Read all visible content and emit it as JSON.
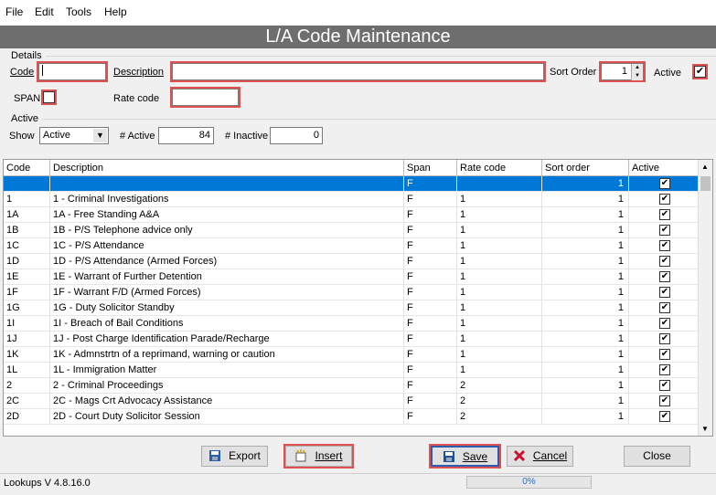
{
  "menu": [
    "File",
    "Edit",
    "Tools",
    "Help"
  ],
  "title": "L/A Code Maintenance",
  "details": {
    "group_label": "Details",
    "code_label": "Code",
    "code_value": "",
    "description_label": "Description",
    "description_value": "",
    "sort_order_label": "Sort Order",
    "sort_order_value": "1",
    "active_label": "Active",
    "active_checked": true,
    "span_label": "SPAN",
    "span_checked": false,
    "rate_code_label": "Rate code",
    "rate_code_value": ""
  },
  "active_group": {
    "group_label": "Active",
    "show_label": "Show",
    "show_value": "Active",
    "active_count_label": "# Active",
    "active_count": "84",
    "inactive_count_label": "# Inactive",
    "inactive_count": "0"
  },
  "grid": {
    "columns": [
      "Code",
      "Description",
      "Span",
      "Rate code",
      "Sort order",
      "Active"
    ],
    "rows": [
      {
        "code": "",
        "description": "",
        "span": "F",
        "rate": "",
        "sort": "1",
        "active": true,
        "selected": true
      },
      {
        "code": "1",
        "description": "1 - Criminal Investigations",
        "span": "F",
        "rate": "1",
        "sort": "1",
        "active": true
      },
      {
        "code": "1A",
        "description": "1A - Free Standing A&A",
        "span": "F",
        "rate": "1",
        "sort": "1",
        "active": true
      },
      {
        "code": "1B",
        "description": "1B - P/S Telephone advice only",
        "span": "F",
        "rate": "1",
        "sort": "1",
        "active": true
      },
      {
        "code": "1C",
        "description": "1C - P/S Attendance",
        "span": "F",
        "rate": "1",
        "sort": "1",
        "active": true
      },
      {
        "code": "1D",
        "description": "1D - P/S Attendance (Armed Forces)",
        "span": "F",
        "rate": "1",
        "sort": "1",
        "active": true
      },
      {
        "code": "1E",
        "description": "1E - Warrant of Further Detention",
        "span": "F",
        "rate": "1",
        "sort": "1",
        "active": true
      },
      {
        "code": "1F",
        "description": "1F - Warrant F/D (Armed Forces)",
        "span": "F",
        "rate": "1",
        "sort": "1",
        "active": true
      },
      {
        "code": "1G",
        "description": "1G - Duty Solicitor Standby",
        "span": "F",
        "rate": "1",
        "sort": "1",
        "active": true
      },
      {
        "code": "1I",
        "description": "1I - Breach of Bail Conditions",
        "span": "F",
        "rate": "1",
        "sort": "1",
        "active": true
      },
      {
        "code": "1J",
        "description": "1J - Post Charge Identification Parade/Recharge",
        "span": "F",
        "rate": "1",
        "sort": "1",
        "active": true
      },
      {
        "code": "1K",
        "description": "1K - Admnstrtn of a reprimand, warning or caution",
        "span": "F",
        "rate": "1",
        "sort": "1",
        "active": true
      },
      {
        "code": "1L",
        "description": "1L - Immigration Matter",
        "span": "F",
        "rate": "1",
        "sort": "1",
        "active": true
      },
      {
        "code": "2",
        "description": "2 - Criminal Proceedings",
        "span": "F",
        "rate": "2",
        "sort": "1",
        "active": true
      },
      {
        "code": "2C",
        "description": "2C - Mags Crt Advocacy Assistance",
        "span": "F",
        "rate": "2",
        "sort": "1",
        "active": true
      },
      {
        "code": "2D",
        "description": "2D - Court Duty Solicitor Session",
        "span": "F",
        "rate": "2",
        "sort": "1",
        "active": true
      }
    ]
  },
  "buttons": {
    "export": "Export",
    "insert": "Insert",
    "save": "Save",
    "cancel": "Cancel",
    "close": "Close"
  },
  "status": {
    "version": "Lookups V 4.8.16.0",
    "progress_text": "0%",
    "progress": 0
  },
  "colors": {
    "title_bg": "#6e6e6e",
    "selection": "#0078d7",
    "highlight": "#e15050"
  },
  "icons": [
    "export-icon",
    "insert-icon",
    "save-icon",
    "cancel-icon"
  ]
}
